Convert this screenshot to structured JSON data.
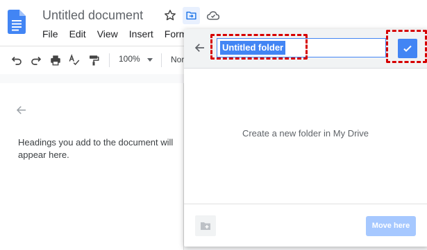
{
  "header": {
    "doc_title": "Untitled document",
    "menu": [
      "File",
      "Edit",
      "View",
      "Insert",
      "Form"
    ]
  },
  "toolbar": {
    "zoom": "100%",
    "style_truncated": "Nor"
  },
  "outline": {
    "hint": "Headings you add to the document will appear here."
  },
  "move_dialog": {
    "folder_name": "Untitled folder",
    "body_text": "Create a new folder in My Drive",
    "move_here_label": "Move here"
  },
  "colors": {
    "accent": "#4285f4",
    "annotation": "#d60000",
    "move_here_disabled": "#a6c8ff"
  }
}
